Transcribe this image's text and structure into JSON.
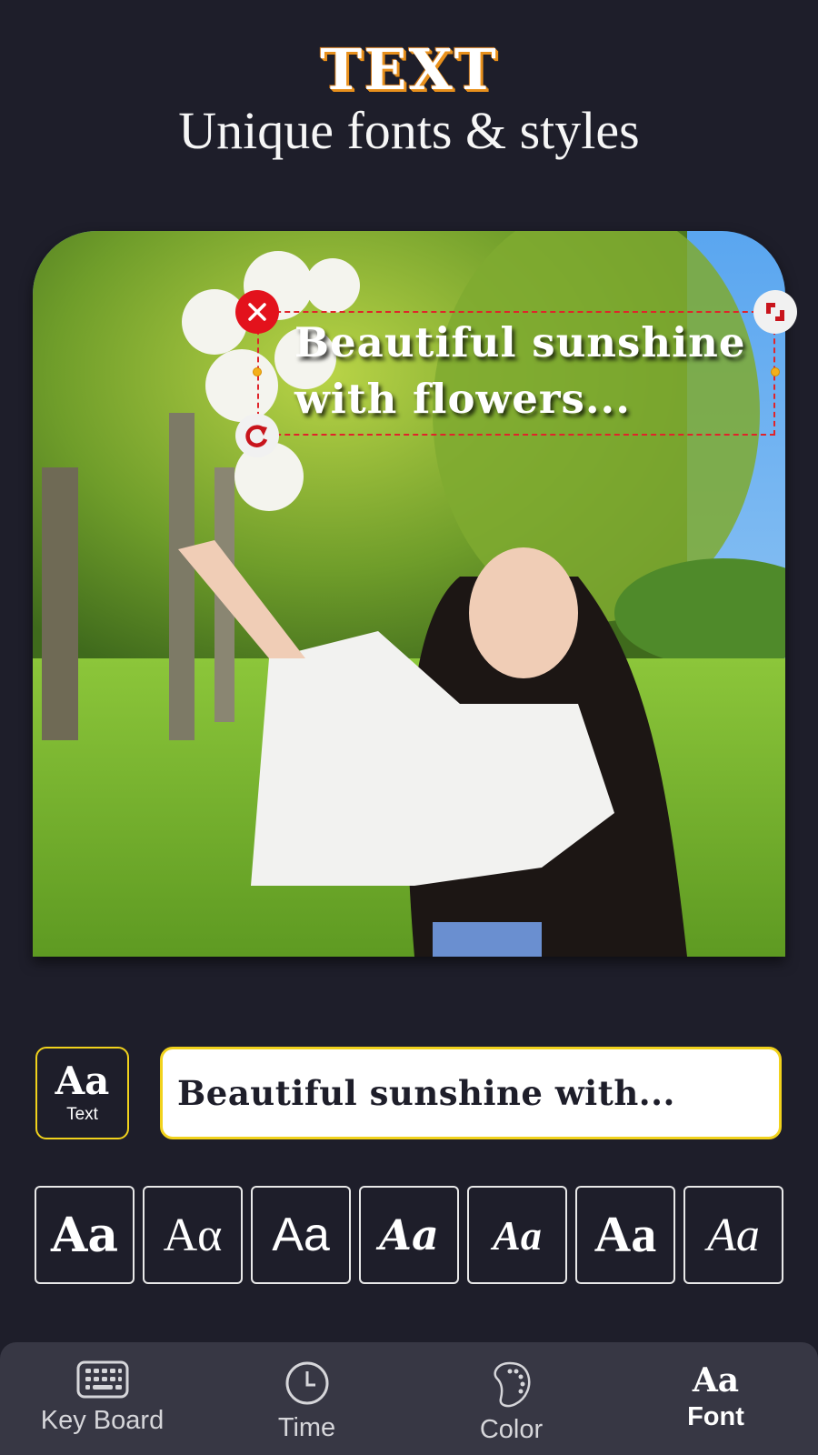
{
  "header": {
    "title": "TEXT",
    "subtitle": "Unique fonts & styles"
  },
  "canvas": {
    "overlay_text_lines": [
      "Beautiful sunshine",
      "with flowers..."
    ],
    "controls": {
      "delete_icon": "close-icon",
      "rotate_icon": "rotate-icon",
      "resize_icon": "resize-icon"
    },
    "colors": {
      "selection": "#e0242a",
      "handle": "#f4b01b"
    }
  },
  "editor": {
    "text_type_button": {
      "glyph": "Aa",
      "label": "Text"
    },
    "text_input_value": "Beautiful sunshine with...",
    "accent": "#f1d21c"
  },
  "font_styles": [
    {
      "glyph": "Aa"
    },
    {
      "glyph": "Aα"
    },
    {
      "glyph": "Aa"
    },
    {
      "glyph": "Aa"
    },
    {
      "glyph": "Aa"
    },
    {
      "glyph": "Aa"
    },
    {
      "glyph": "Aa"
    }
  ],
  "bottom_nav": {
    "items": [
      {
        "label": "Key Board",
        "icon": "keyboard-icon"
      },
      {
        "label": "Time",
        "icon": "clock-icon"
      },
      {
        "label": "Color",
        "icon": "palette-icon"
      },
      {
        "label": "Font",
        "icon": "font-icon",
        "glyph": "Aa",
        "active": true
      }
    ]
  }
}
